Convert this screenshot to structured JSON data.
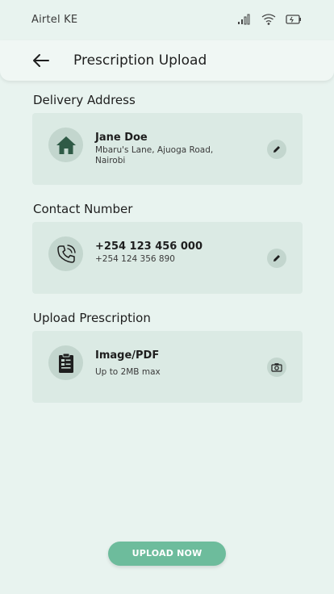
{
  "status_bar": {
    "carrier": "Airtel KE"
  },
  "header": {
    "title": "Prescription Upload"
  },
  "sections": {
    "delivery": {
      "title": "Delivery Address",
      "name": "Jane Doe",
      "address": "Mbaru's Lane, Ajuoga Road, Nairobi"
    },
    "contact": {
      "title": "Contact Number",
      "primary": "+254 123 456 000",
      "secondary": "+254 124 356 890"
    },
    "upload": {
      "title": "Upload Prescription",
      "primary": "Image/PDF",
      "secondary": "Up to 2MB max"
    }
  },
  "footer": {
    "upload_button": "UPLOAD NOW"
  },
  "colors": {
    "background": "#e8f3ef",
    "card": "#dbeae4",
    "accent": "#6dbc9c",
    "icon": "#2f5a46"
  }
}
